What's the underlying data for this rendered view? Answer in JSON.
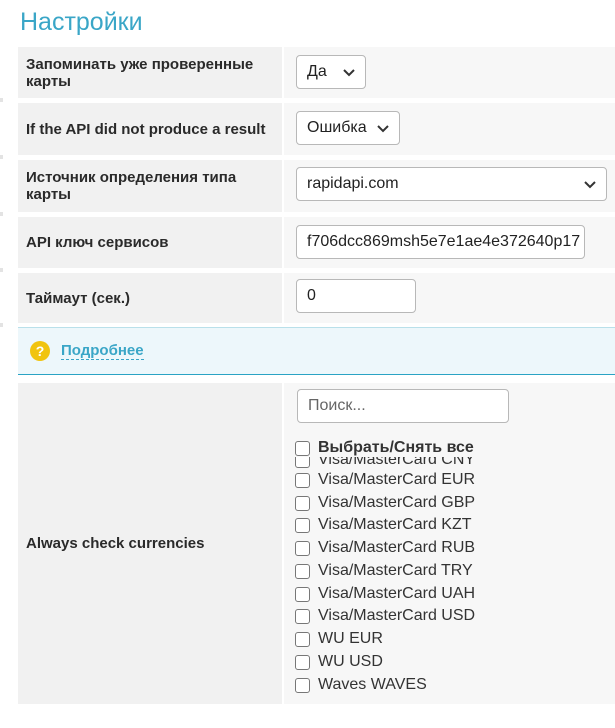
{
  "page": {
    "title": "Настройки"
  },
  "settings": {
    "remember_cards": {
      "label": "Запоминать уже проверенные карты",
      "value": "Да"
    },
    "api_no_result": {
      "label": "If the API did not produce a result",
      "value": "Ошибка"
    },
    "card_type_source": {
      "label": "Источник определения типа карты",
      "value": "rapidapi.com"
    },
    "api_key": {
      "label": "API ключ сервисов",
      "value": "f706dcc869msh5e7e1ae4e372640p17"
    },
    "timeout": {
      "label": "Таймаут (сек.)",
      "value": "0"
    }
  },
  "info": {
    "link_label": "Подробнее",
    "icon": "question-icon"
  },
  "currencies": {
    "label": "Always check currencies",
    "search_placeholder": "Поиск...",
    "select_all_label": "Выбрать/Снять все",
    "items": [
      "Visa/MasterCard CNY",
      "Visa/MasterCard EUR",
      "Visa/MasterCard GBP",
      "Visa/MasterCard KZT",
      "Visa/MasterCard RUB",
      "Visa/MasterCard TRY",
      "Visa/MasterCard UAH",
      "Visa/MasterCard USD",
      "WU EUR",
      "WU USD",
      "Waves WAVES"
    ]
  },
  "colors": {
    "accent": "#3aa6c7",
    "info_bg": "#edf7fb",
    "info_icon": "#f1c40f"
  }
}
